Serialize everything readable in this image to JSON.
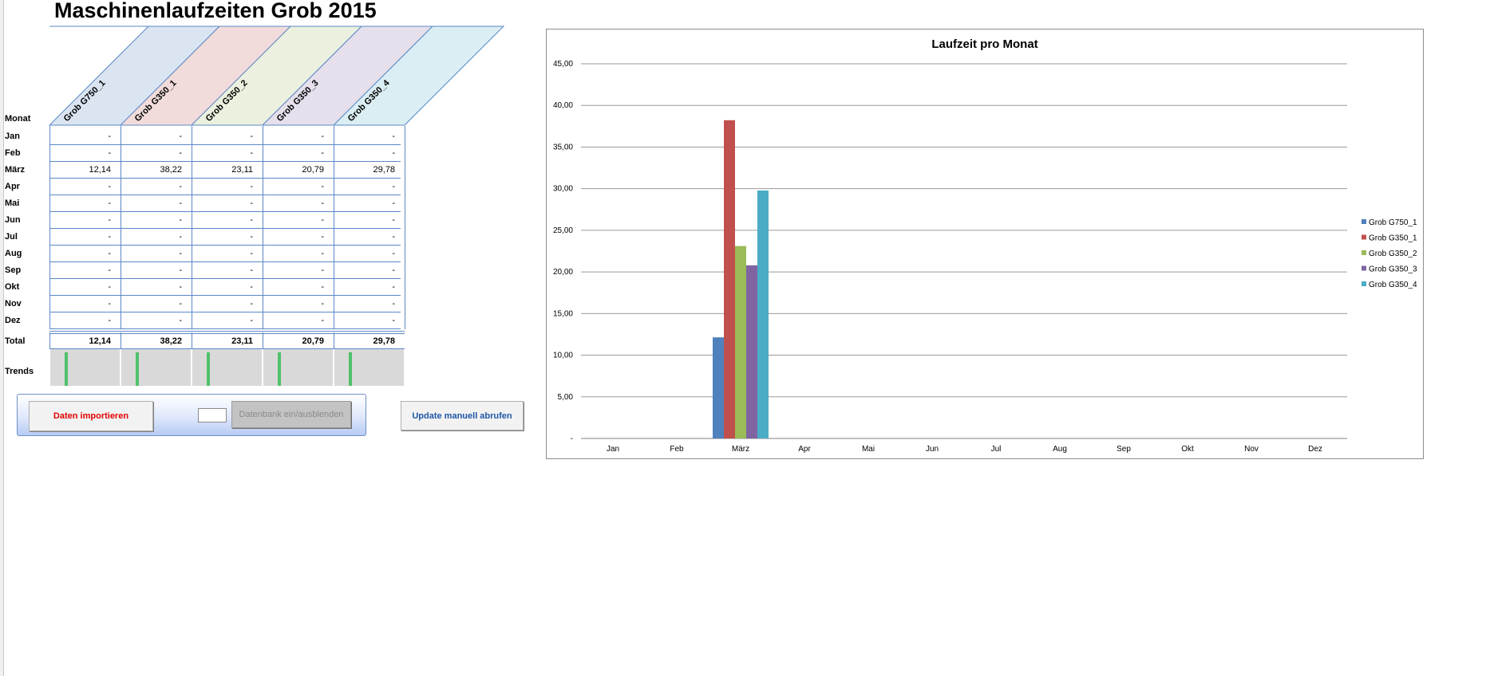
{
  "title": "Maschinenlaufzeiten Grob 2015",
  "table": {
    "month_header": "Monat",
    "machines": [
      "Grob G750_1",
      "Grob G350_1",
      "Grob G350_2",
      "Grob G350_3",
      "Grob G350_4"
    ],
    "header_colors": [
      "#dbe5f1",
      "#f2dcdb",
      "#ebf1de",
      "#e5e0ec",
      "#daeef3"
    ],
    "rows": [
      {
        "month": "Jan",
        "values": [
          "-",
          "-",
          "-",
          "-",
          "-"
        ]
      },
      {
        "month": "Feb",
        "values": [
          "-",
          "-",
          "-",
          "-",
          "-"
        ]
      },
      {
        "month": "März",
        "values": [
          "12,14",
          "38,22",
          "23,11",
          "20,79",
          "29,78"
        ]
      },
      {
        "month": "Apr",
        "values": [
          "-",
          "-",
          "-",
          "-",
          "-"
        ]
      },
      {
        "month": "Mai",
        "values": [
          "-",
          "-",
          "-",
          "-",
          "-"
        ]
      },
      {
        "month": "Jun",
        "values": [
          "-",
          "-",
          "-",
          "-",
          "-"
        ]
      },
      {
        "month": "Jul",
        "values": [
          "-",
          "-",
          "-",
          "-",
          "-"
        ]
      },
      {
        "month": "Aug",
        "values": [
          "-",
          "-",
          "-",
          "-",
          "-"
        ]
      },
      {
        "month": "Sep",
        "values": [
          "-",
          "-",
          "-",
          "-",
          "-"
        ]
      },
      {
        "month": "Okt",
        "values": [
          "-",
          "-",
          "-",
          "-",
          "-"
        ]
      },
      {
        "month": "Nov",
        "values": [
          "-",
          "-",
          "-",
          "-",
          "-"
        ]
      },
      {
        "month": "Dez",
        "values": [
          "-",
          "-",
          "-",
          "-",
          "-"
        ]
      }
    ],
    "total_label": "Total",
    "totals": [
      "12,14",
      "38,22",
      "23,11",
      "20,79",
      "29,78"
    ],
    "trends_label": "Trends",
    "trend_color": "#4fc16b"
  },
  "controls": {
    "import_label": "Daten importieren",
    "db_toggle_label": "Datenbank ein/ausblenden",
    "update_label": "Update manuell abrufen",
    "import_color": "#e00000",
    "update_color": "#1f57a8"
  },
  "chart_data": {
    "type": "bar",
    "title": "Laufzeit pro Monat",
    "categories": [
      "Jan",
      "Feb",
      "März",
      "Apr",
      "Mai",
      "Jun",
      "Jul",
      "Aug",
      "Sep",
      "Okt",
      "Nov",
      "Dez"
    ],
    "series": [
      {
        "name": "Grob G750_1",
        "color": "#4f81bd",
        "values": [
          0,
          0,
          12.14,
          0,
          0,
          0,
          0,
          0,
          0,
          0,
          0,
          0
        ]
      },
      {
        "name": "Grob G350_1",
        "color": "#c0504d",
        "values": [
          0,
          0,
          38.22,
          0,
          0,
          0,
          0,
          0,
          0,
          0,
          0,
          0
        ]
      },
      {
        "name": "Grob G350_2",
        "color": "#9bbb59",
        "values": [
          0,
          0,
          23.11,
          0,
          0,
          0,
          0,
          0,
          0,
          0,
          0,
          0
        ]
      },
      {
        "name": "Grob G350_3",
        "color": "#8064a2",
        "values": [
          0,
          0,
          20.79,
          0,
          0,
          0,
          0,
          0,
          0,
          0,
          0,
          0
        ]
      },
      {
        "name": "Grob G350_4",
        "color": "#4bacc6",
        "values": [
          0,
          0,
          29.78,
          0,
          0,
          0,
          0,
          0,
          0,
          0,
          0,
          0
        ]
      }
    ],
    "y_tick_labels": [
      "-",
      "5,00",
      "10,00",
      "15,00",
      "20,00",
      "25,00",
      "30,00",
      "35,00",
      "40,00",
      "45,00"
    ],
    "ylim": [
      0,
      45
    ],
    "grid": true,
    "legend_position": "right"
  }
}
